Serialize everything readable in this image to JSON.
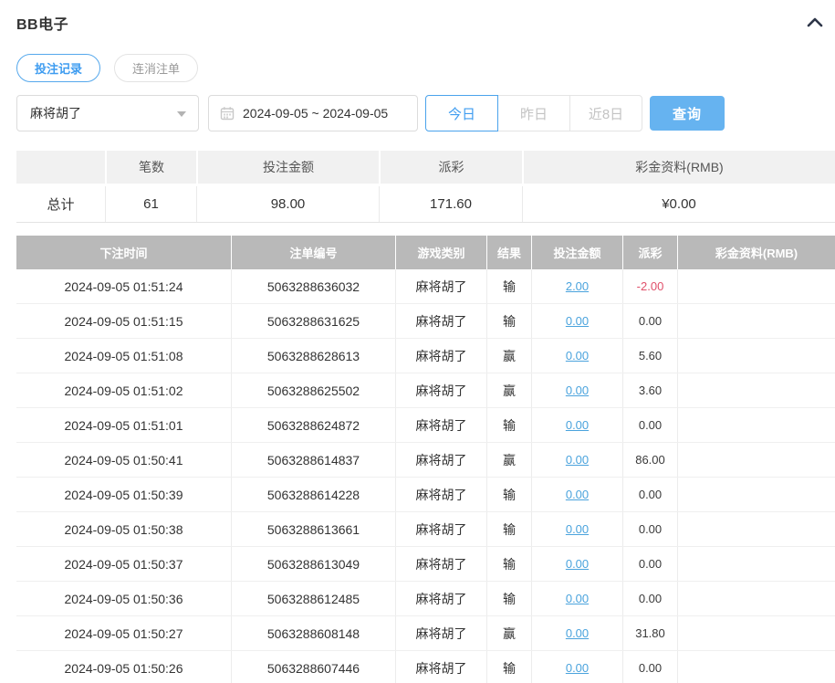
{
  "header": {
    "title": "BB电子",
    "collapse_icon": "chevron-up"
  },
  "tabs": [
    {
      "label": "投注记录",
      "active": true
    },
    {
      "label": "连消注单",
      "active": false
    }
  ],
  "filters": {
    "game_select": {
      "value": "麻将胡了",
      "icon": "caret-down"
    },
    "date_range": {
      "value": "2024-09-05 ~ 2024-09-05",
      "icon": "calendar-icon"
    },
    "quick_ranges": [
      {
        "label": "今日",
        "active": true
      },
      {
        "label": "昨日",
        "active": false
      },
      {
        "label": "近8日",
        "active": false
      }
    ],
    "search_label": "查询"
  },
  "summary": {
    "columns": [
      "",
      "笔数",
      "投注金额",
      "派彩",
      "彩金资料(RMB)"
    ],
    "row": {
      "label": "总计",
      "count": "61",
      "bet_amount": "98.00",
      "payout": "171.60",
      "bonus": "¥0.00"
    }
  },
  "table": {
    "columns": [
      "下注时间",
      "注单编号",
      "游戏类别",
      "结果",
      "投注金额",
      "派彩",
      "彩金资料(RMB)"
    ],
    "rows": [
      {
        "time": "2024-09-05 01:51:24",
        "order_id": "5063288636032",
        "game": "麻将胡了",
        "result": "输",
        "bet": "2.00",
        "payout": "-2.00",
        "bonus": ""
      },
      {
        "time": "2024-09-05 01:51:15",
        "order_id": "5063288631625",
        "game": "麻将胡了",
        "result": "输",
        "bet": "0.00",
        "payout": "0.00",
        "bonus": ""
      },
      {
        "time": "2024-09-05 01:51:08",
        "order_id": "5063288628613",
        "game": "麻将胡了",
        "result": "赢",
        "bet": "0.00",
        "payout": "5.60",
        "bonus": ""
      },
      {
        "time": "2024-09-05 01:51:02",
        "order_id": "5063288625502",
        "game": "麻将胡了",
        "result": "赢",
        "bet": "0.00",
        "payout": "3.60",
        "bonus": ""
      },
      {
        "time": "2024-09-05 01:51:01",
        "order_id": "5063288624872",
        "game": "麻将胡了",
        "result": "输",
        "bet": "0.00",
        "payout": "0.00",
        "bonus": ""
      },
      {
        "time": "2024-09-05 01:50:41",
        "order_id": "5063288614837",
        "game": "麻将胡了",
        "result": "赢",
        "bet": "0.00",
        "payout": "86.00",
        "bonus": ""
      },
      {
        "time": "2024-09-05 01:50:39",
        "order_id": "5063288614228",
        "game": "麻将胡了",
        "result": "输",
        "bet": "0.00",
        "payout": "0.00",
        "bonus": ""
      },
      {
        "time": "2024-09-05 01:50:38",
        "order_id": "5063288613661",
        "game": "麻将胡了",
        "result": "输",
        "bet": "0.00",
        "payout": "0.00",
        "bonus": ""
      },
      {
        "time": "2024-09-05 01:50:37",
        "order_id": "5063288613049",
        "game": "麻将胡了",
        "result": "输",
        "bet": "0.00",
        "payout": "0.00",
        "bonus": ""
      },
      {
        "time": "2024-09-05 01:50:36",
        "order_id": "5063288612485",
        "game": "麻将胡了",
        "result": "输",
        "bet": "0.00",
        "payout": "0.00",
        "bonus": ""
      },
      {
        "time": "2024-09-05 01:50:27",
        "order_id": "5063288608148",
        "game": "麻将胡了",
        "result": "赢",
        "bet": "0.00",
        "payout": "31.80",
        "bonus": ""
      },
      {
        "time": "2024-09-05 01:50:26",
        "order_id": "5063288607446",
        "game": "麻将胡了",
        "result": "输",
        "bet": "0.00",
        "payout": "0.00",
        "bonus": ""
      }
    ]
  },
  "colors": {
    "accent_blue": "#3e9cf0",
    "search_button_fill": "#66b3f0",
    "link_blue": "#4aa3dd",
    "negative_red": "#e0506a",
    "table_header_gray": "#b9b9b9",
    "summary_header_gray": "#f1f1f1"
  }
}
